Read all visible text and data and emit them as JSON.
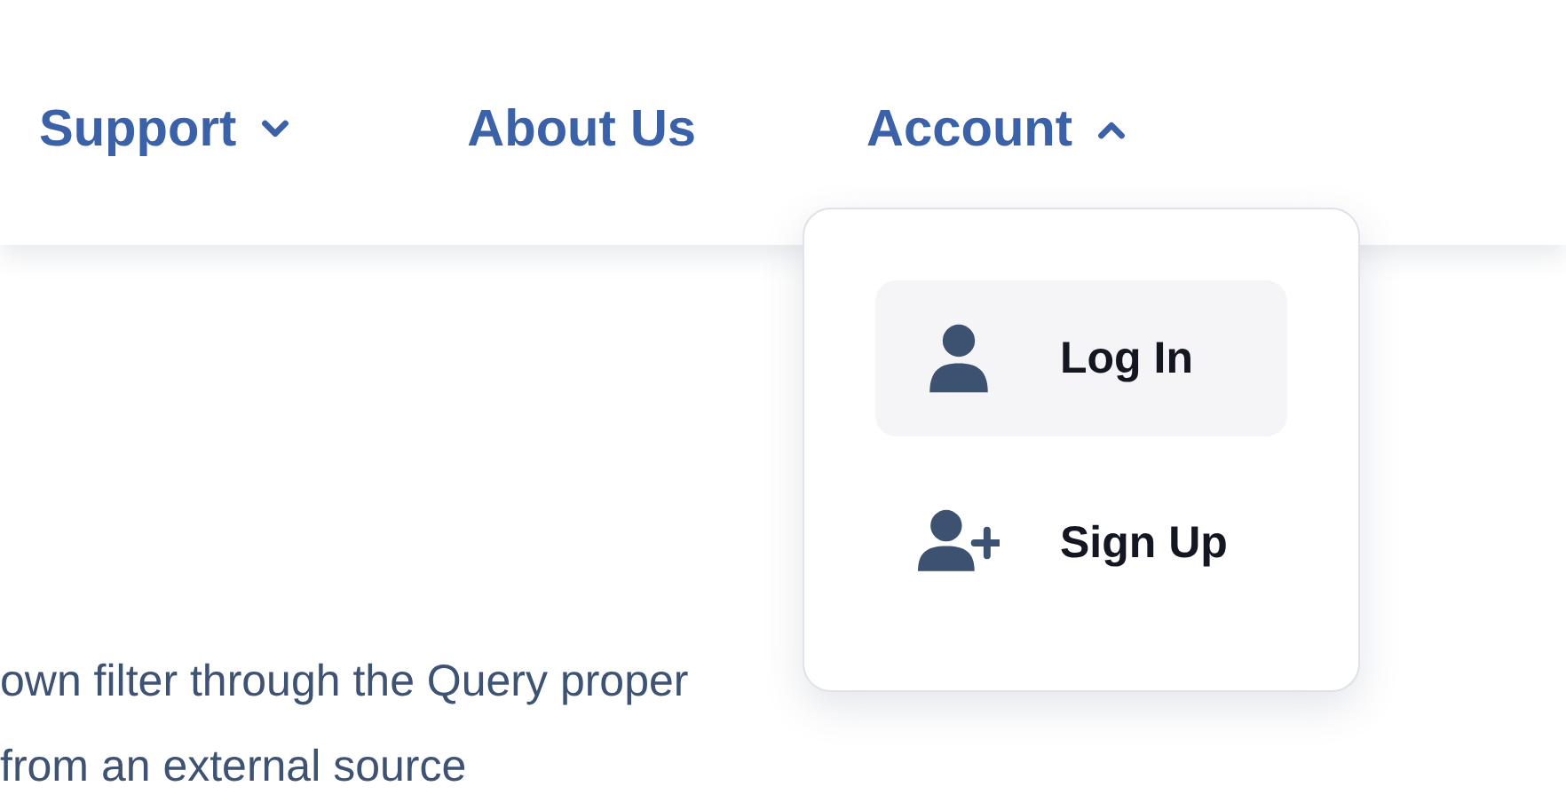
{
  "nav": [
    {
      "label": "Support",
      "expanded": false
    },
    {
      "label": "About Us"
    },
    {
      "label": "Account",
      "expanded": true
    }
  ],
  "account_menu": [
    {
      "label": "Log In",
      "kind": "login",
      "selected": true
    },
    {
      "label": "Sign Up",
      "kind": "signup",
      "selected": false
    }
  ],
  "body_lines": [
    "own filter through the Query proper",
    "from an external source"
  ]
}
